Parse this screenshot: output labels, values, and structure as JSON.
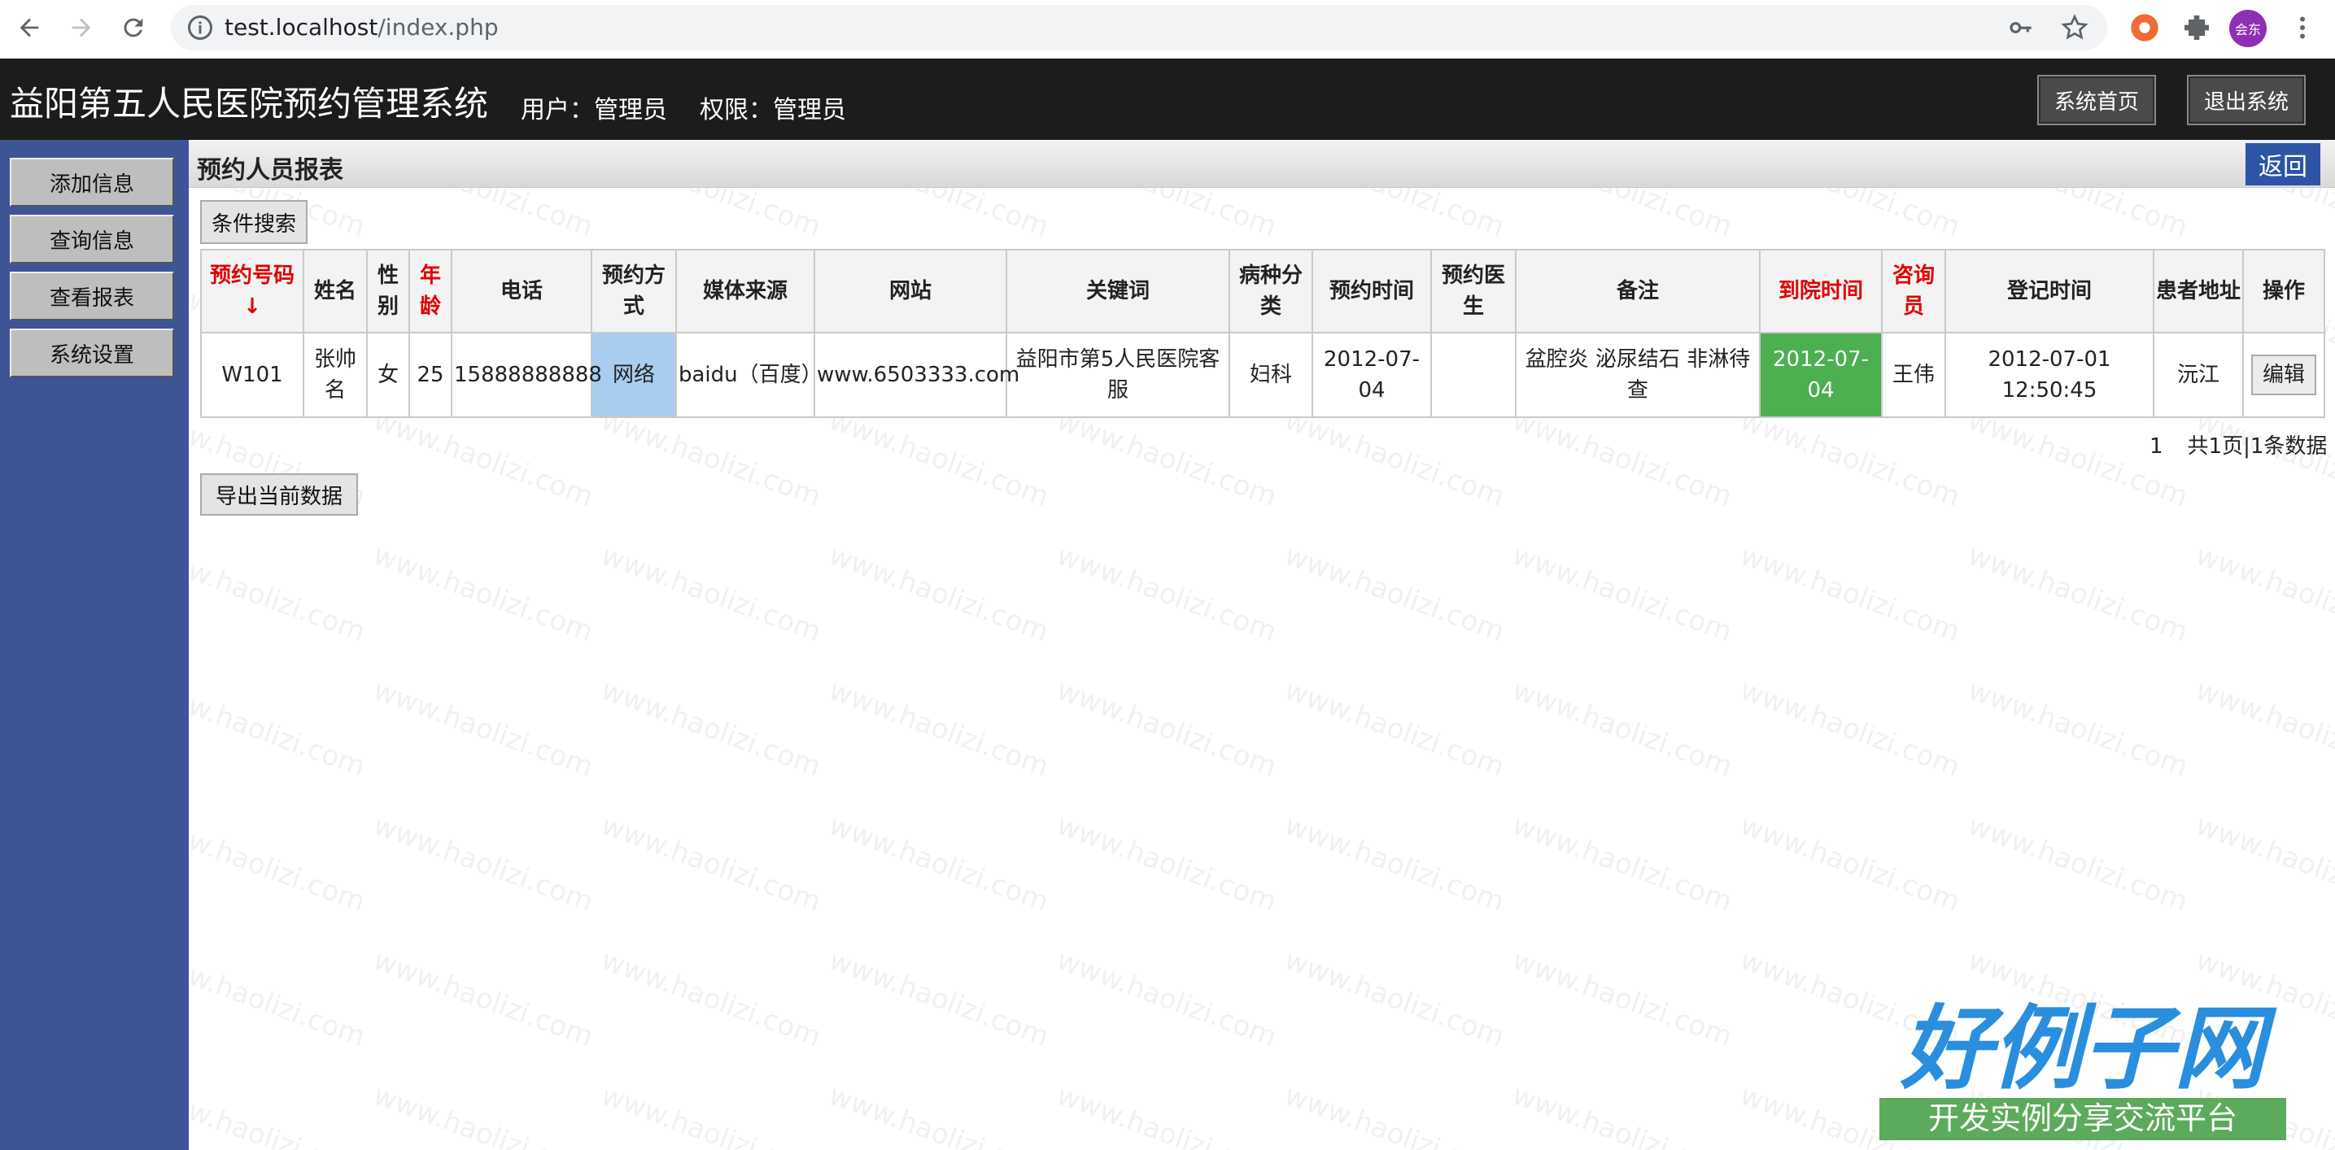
{
  "browser": {
    "url_host": "test.localhost",
    "url_path": "/index.php",
    "profile_initials": "会东"
  },
  "header": {
    "app_title": "益阳第五人民医院预约管理系统",
    "user_label": "用户：管理员",
    "role_label": "权限：管理员",
    "home_button": "系统首页",
    "logout_button": "退出系统"
  },
  "sidebar": {
    "items": [
      {
        "label": "添加信息"
      },
      {
        "label": "查询信息"
      },
      {
        "label": "查看报表"
      },
      {
        "label": "系统设置"
      }
    ]
  },
  "main": {
    "page_title": "预约人员报表",
    "back_button": "返回",
    "search_button": "条件搜索",
    "export_button": "导出当前数据",
    "watermark_text": "www.haolizi.com",
    "table": {
      "headers": [
        {
          "label": "预约号码↓",
          "highlight": true
        },
        {
          "label": "姓名",
          "highlight": false
        },
        {
          "label": "性别",
          "highlight": false
        },
        {
          "label": "年龄",
          "highlight": true
        },
        {
          "label": "电话",
          "highlight": false
        },
        {
          "label": "预约方式",
          "highlight": false
        },
        {
          "label": "媒体来源",
          "highlight": false
        },
        {
          "label": "网站",
          "highlight": false
        },
        {
          "label": "关键词",
          "highlight": false
        },
        {
          "label": "病种分类",
          "highlight": false
        },
        {
          "label": "预约时间",
          "highlight": false
        },
        {
          "label": "预约医生",
          "highlight": false
        },
        {
          "label": "备注",
          "highlight": false
        },
        {
          "label": "到院时间",
          "highlight": true
        },
        {
          "label": "咨询员",
          "highlight": true
        },
        {
          "label": "登记时间",
          "highlight": false
        },
        {
          "label": "患者地址",
          "highlight": false
        },
        {
          "label": "操作",
          "highlight": false
        }
      ],
      "rows": [
        {
          "id": "W101",
          "name": "张帅名",
          "gender": "女",
          "age": "25",
          "phone": "15888888888",
          "method": "网络",
          "media": "baidu（百度）",
          "website": "www.6503333.com",
          "keyword": "益阳市第5人民医院客服",
          "category": "妇科",
          "appointment_time": "2012-07-04",
          "doctor": "",
          "remark": "盆腔炎 泌尿结石 非淋待查",
          "arrival_time": "2012-07-04",
          "consultant": "王伟",
          "register_time": "2012-07-01 12:50:45",
          "address": "沅江",
          "action": "编辑"
        }
      ]
    },
    "pager": {
      "current_page": "1",
      "summary": "共1页|1条数据"
    }
  },
  "brand": {
    "logo_text": "好例子网",
    "tagline": "开发实例分享交流平台"
  },
  "colors": {
    "header_bg": "#1c1c1c",
    "sidebar_bg": "#3d5597",
    "back_button": "#2d55a6",
    "highlight_header": "#e00000",
    "method_cell": "#a9cdf0",
    "arrival_cell": "#4caf50"
  }
}
